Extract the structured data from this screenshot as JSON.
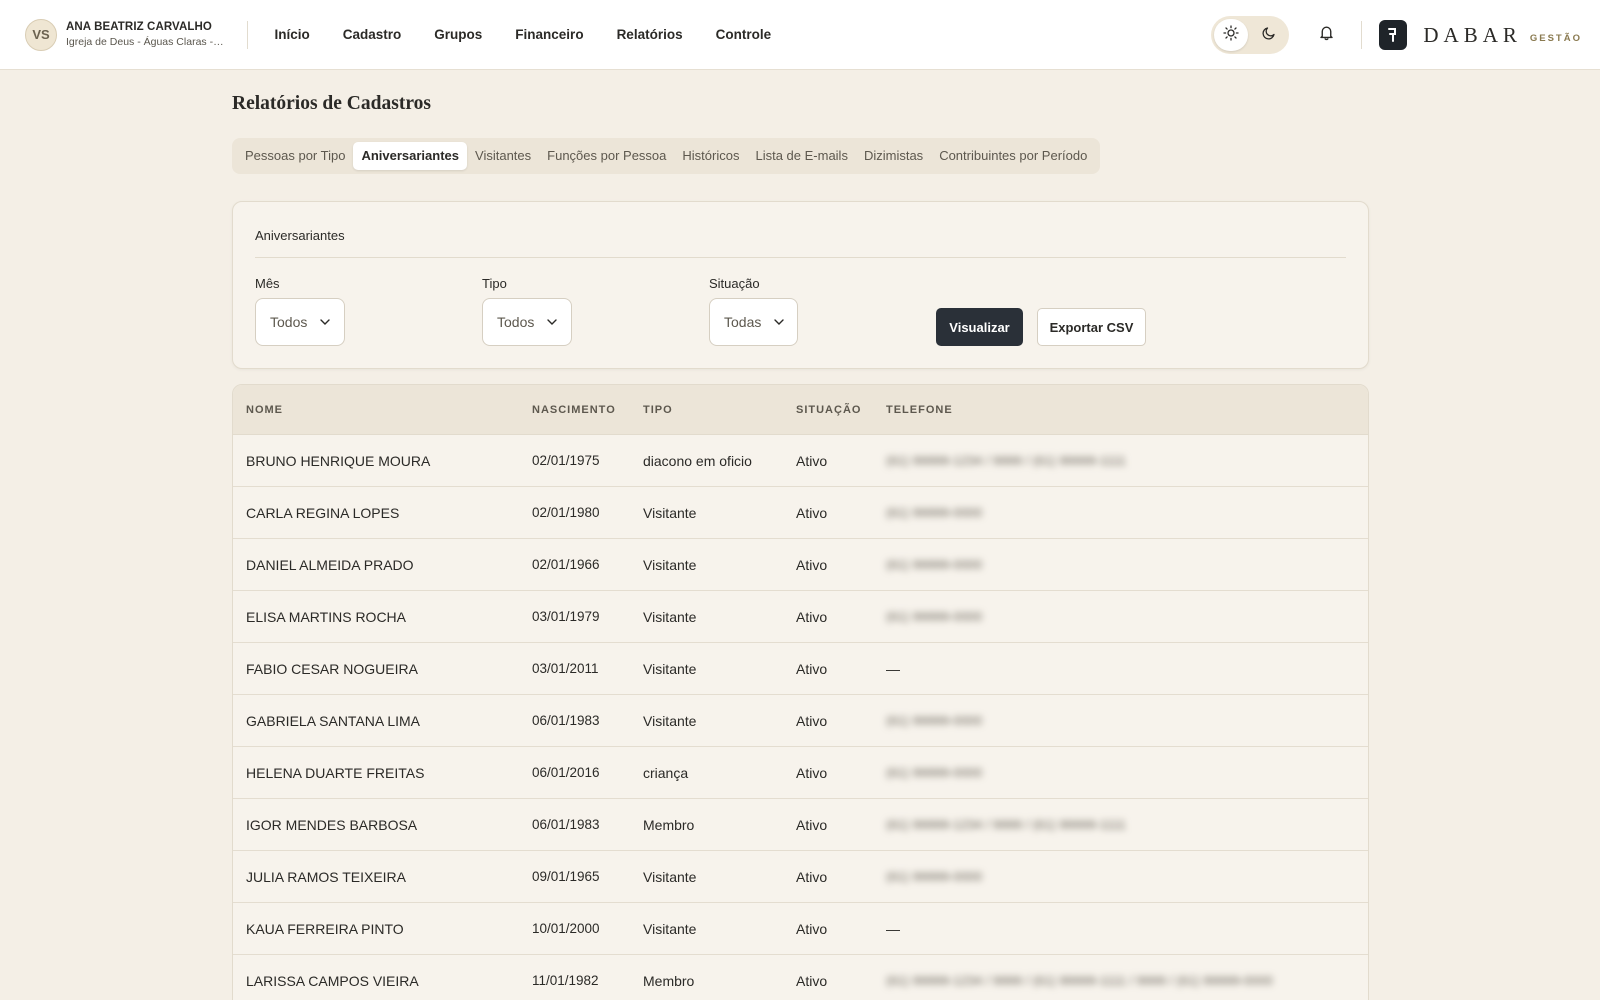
{
  "user": {
    "initials": "VS",
    "name": "ANA BEATRIZ CARVALHO",
    "org": "Igreja de Deus - Águas Claras - I..."
  },
  "nav": [
    "Início",
    "Cadastro",
    "Grupos",
    "Financeiro",
    "Relatórios",
    "Controle"
  ],
  "brand": {
    "name": "DABAR",
    "sub": "GESTÃO"
  },
  "icons": {
    "theme_light": "sun-icon",
    "theme_dark": "moon-icon",
    "notifications": "bell-icon",
    "brand_logo": "brand-logo-icon",
    "select_chevron": "chevron-down-icon"
  },
  "colors": {
    "accent_dark": "#2a3038",
    "background": "#f4efe6",
    "brand_sub": "#8a7a50"
  },
  "page": {
    "title": "Relatórios de Cadastros"
  },
  "tabs": [
    {
      "label": "Pessoas por Tipo",
      "active": false
    },
    {
      "label": "Aniversariantes",
      "active": true
    },
    {
      "label": "Visitantes",
      "active": false
    },
    {
      "label": "Funções por Pessoa",
      "active": false
    },
    {
      "label": "Históricos",
      "active": false
    },
    {
      "label": "Lista de E-mails",
      "active": false
    },
    {
      "label": "Dizimistas",
      "active": false
    },
    {
      "label": "Contribuintes por Período",
      "active": false
    }
  ],
  "filters": {
    "title": "Aniversariantes",
    "mes": {
      "label": "Mês",
      "value": "Todos"
    },
    "tipo": {
      "label": "Tipo",
      "value": "Todos"
    },
    "situacao": {
      "label": "Situação",
      "value": "Todas"
    },
    "visualizar_label": "Visualizar",
    "exportar_label": "Exportar CSV"
  },
  "table": {
    "columns": [
      "NOME",
      "NASCIMENTO",
      "TIPO",
      "SITUAÇÃO",
      "TELEFONE"
    ],
    "rows": [
      {
        "nome": "BRUNO HENRIQUE MOURA",
        "nascimento": "02/01/1975",
        "tipo": "diacono em oficio",
        "situacao": "Ativo",
        "telefone": "(61) 99999-1234 / 9999 / (61) 99999-1111",
        "telefone_blurred": true
      },
      {
        "nome": "CARLA REGINA LOPES",
        "nascimento": "02/01/1980",
        "tipo": "Visitante",
        "situacao": "Ativo",
        "telefone": "(61) 99999-0000",
        "telefone_blurred": true
      },
      {
        "nome": "DANIEL ALMEIDA PRADO",
        "nascimento": "02/01/1966",
        "tipo": "Visitante",
        "situacao": "Ativo",
        "telefone": "(61) 99999-0000",
        "telefone_blurred": true
      },
      {
        "nome": "ELISA MARTINS ROCHA",
        "nascimento": "03/01/1979",
        "tipo": "Visitante",
        "situacao": "Ativo",
        "telefone": "(61) 99999-0000",
        "telefone_blurred": true
      },
      {
        "nome": "FABIO CESAR NOGUEIRA",
        "nascimento": "03/01/2011",
        "tipo": "Visitante",
        "situacao": "Ativo",
        "telefone": "—",
        "telefone_blurred": false
      },
      {
        "nome": "GABRIELA SANTANA LIMA",
        "nascimento": "06/01/1983",
        "tipo": "Visitante",
        "situacao": "Ativo",
        "telefone": "(61) 99999-0000",
        "telefone_blurred": true
      },
      {
        "nome": "HELENA DUARTE FREITAS",
        "nascimento": "06/01/2016",
        "tipo": "criança",
        "situacao": "Ativo",
        "telefone": "(61) 99999-0000",
        "telefone_blurred": true
      },
      {
        "nome": "IGOR MENDES BARBOSA",
        "nascimento": "06/01/1983",
        "tipo": "Membro",
        "situacao": "Ativo",
        "telefone": "(61) 99999-1234 / 9999 / (61) 99999-1111",
        "telefone_blurred": true
      },
      {
        "nome": "JULIA RAMOS TEIXEIRA",
        "nascimento": "09/01/1965",
        "tipo": "Visitante",
        "situacao": "Ativo",
        "telefone": "(61) 99999-0000",
        "telefone_blurred": true
      },
      {
        "nome": "KAUA FERREIRA PINTO",
        "nascimento": "10/01/2000",
        "tipo": "Visitante",
        "situacao": "Ativo",
        "telefone": "—",
        "telefone_blurred": false
      },
      {
        "nome": "LARISSA CAMPOS VIEIRA",
        "nascimento": "11/01/1982",
        "tipo": "Membro",
        "situacao": "Ativo",
        "telefone": "(61) 99999-1234 / 9999 / (61) 99999-1111 / 9999 / (61) 99999-0000",
        "telefone_blurred": true
      }
    ]
  }
}
